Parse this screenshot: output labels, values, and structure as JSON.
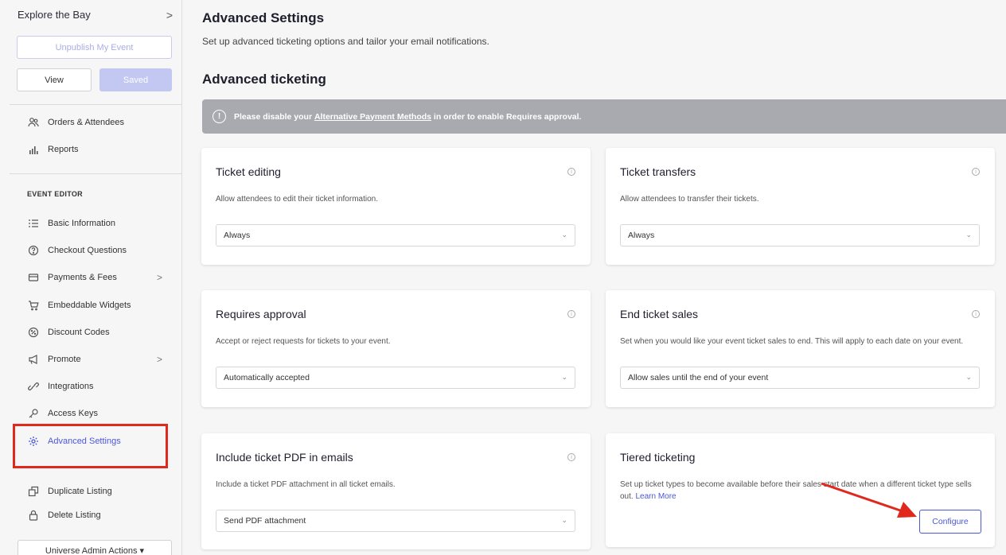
{
  "sidebar": {
    "event_name": "Explore the Bay",
    "event_chevron": ">",
    "unpublish_label": "Unpublish My Event",
    "view_label": "View",
    "saved_label": "Saved",
    "top_items": [
      {
        "label": "Orders & Attendees",
        "icon": "people-icon"
      },
      {
        "label": "Reports",
        "icon": "bar-chart-icon"
      }
    ],
    "editor_heading": "EVENT EDITOR",
    "editor_items": [
      {
        "label": "Basic Information",
        "icon": "list-icon"
      },
      {
        "label": "Checkout Questions",
        "icon": "question-icon"
      },
      {
        "label": "Payments & Fees",
        "icon": "card-icon",
        "chevron": ">"
      },
      {
        "label": "Embeddable Widgets",
        "icon": "cart-icon"
      },
      {
        "label": "Discount Codes",
        "icon": "discount-icon"
      },
      {
        "label": "Promote",
        "icon": "megaphone-icon",
        "chevron": ">"
      },
      {
        "label": "Integrations",
        "icon": "link-icon"
      },
      {
        "label": "Access Keys",
        "icon": "key-icon"
      },
      {
        "label": "Advanced Settings",
        "icon": "gear-icon",
        "active": true
      }
    ],
    "bottom_items": [
      {
        "label": "Duplicate Listing",
        "icon": "duplicate-icon"
      },
      {
        "label": "Delete Listing",
        "icon": "lock-icon"
      }
    ],
    "admin_actions_label": "Universe Admin Actions ▾"
  },
  "main": {
    "title": "Advanced Settings",
    "subtitle": "Set up advanced ticketing options and tailor your email notifications.",
    "section_title": "Advanced ticketing",
    "alert": {
      "icon": "!",
      "prefix": "Please disable your ",
      "link": "Alternative Payment Methods",
      "suffix": " in order to enable Requires approval."
    },
    "cards": {
      "ticket_editing": {
        "title": "Ticket editing",
        "description": "Allow attendees to edit their ticket information.",
        "value": "Always"
      },
      "ticket_transfers": {
        "title": "Ticket transfers",
        "description": "Allow attendees to transfer their tickets.",
        "value": "Always"
      },
      "requires_approval": {
        "title": "Requires approval",
        "description": "Accept or reject requests for tickets to your event.",
        "value": "Automatically accepted"
      },
      "end_ticket_sales": {
        "title": "End ticket sales",
        "description": "Set when you would like your event ticket sales to end. This will apply to each date on your event.",
        "value": "Allow sales until the end of your event"
      },
      "include_pdf": {
        "title": "Include ticket PDF in emails",
        "description": "Include a ticket PDF attachment in all ticket emails.",
        "value": "Send PDF attachment"
      },
      "tiered_ticketing": {
        "title": "Tiered ticketing",
        "description": "Set up ticket types to become available before their sales start date when a different ticket type sells out.",
        "learn_more": "Learn More",
        "button_label": "Configure"
      }
    },
    "info_glyph": "i",
    "caret_glyph": "⌄"
  },
  "colors": {
    "accent": "#4b57d8",
    "highlight": "#e0281d",
    "alert_bg": "#a8aaaf"
  }
}
